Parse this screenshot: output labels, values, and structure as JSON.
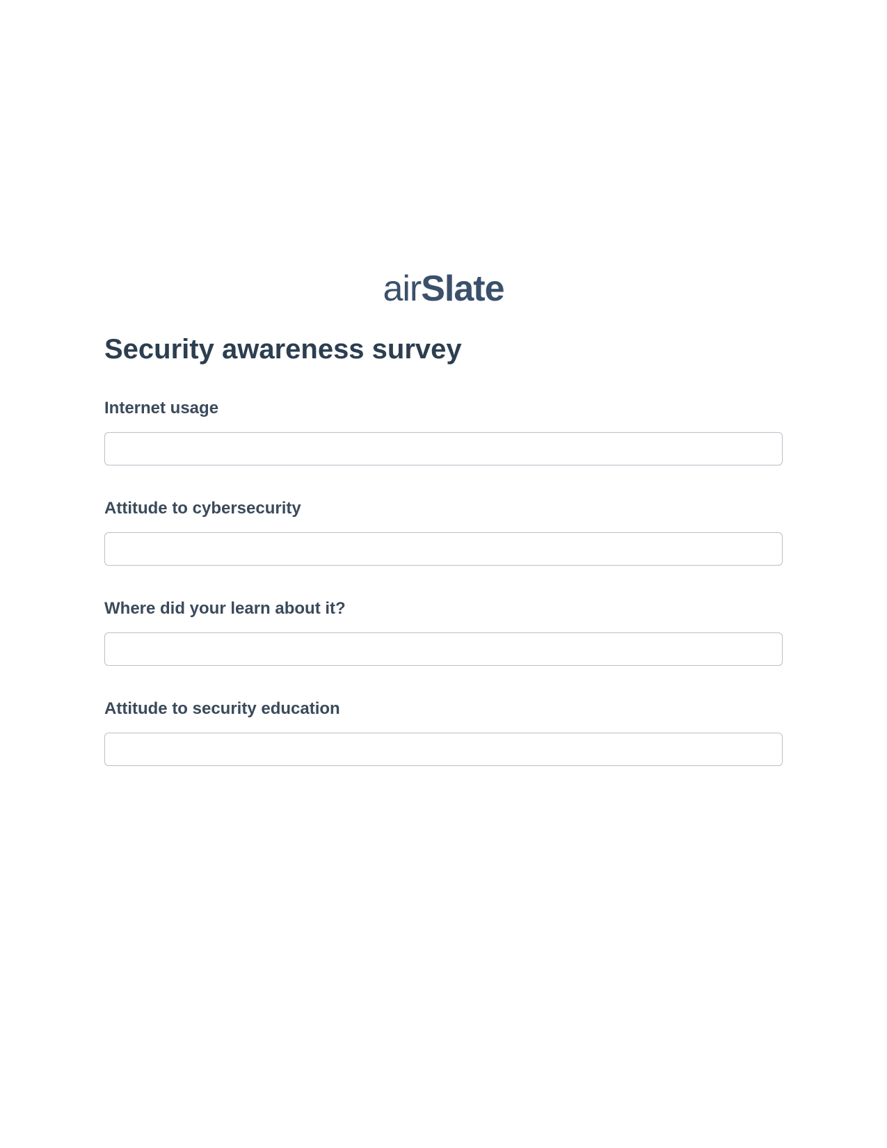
{
  "logo": {
    "part1": "air",
    "part2": "Slate"
  },
  "form": {
    "title": "Security awareness survey",
    "fields": [
      {
        "label": "Internet usage",
        "value": ""
      },
      {
        "label": "Attitude to cybersecurity",
        "value": ""
      },
      {
        "label": "Where did your learn about it?",
        "value": ""
      },
      {
        "label": "Attitude to security education",
        "value": ""
      }
    ]
  }
}
